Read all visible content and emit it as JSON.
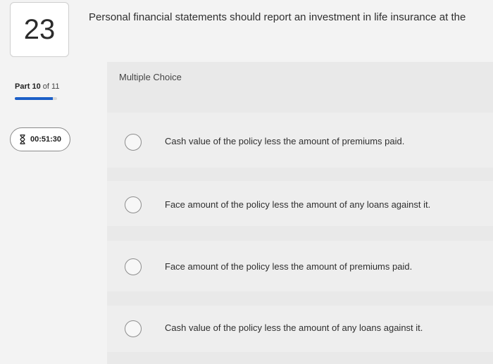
{
  "question": {
    "number": "23",
    "text": "Personal financial statements should report an investment in life insurance at the",
    "type": "Multiple Choice"
  },
  "progress": {
    "part_word": "Part",
    "part_current": "10",
    "part_of": "of 11",
    "fraction": 0.9
  },
  "timer": {
    "icon": "hourglass-icon",
    "time": "00:51:30"
  },
  "choices": [
    {
      "label": "Cash value of the policy less the amount of premiums paid."
    },
    {
      "label": "Face amount of the policy less the amount of any loans against it."
    },
    {
      "label": "Face amount of the policy less the amount of premiums paid."
    },
    {
      "label": "Cash value of the policy less the amount of any loans against it."
    }
  ],
  "colors": {
    "accent": "#1c5fc7",
    "background": "#f3f3f3",
    "band": "#e9e9e9"
  }
}
